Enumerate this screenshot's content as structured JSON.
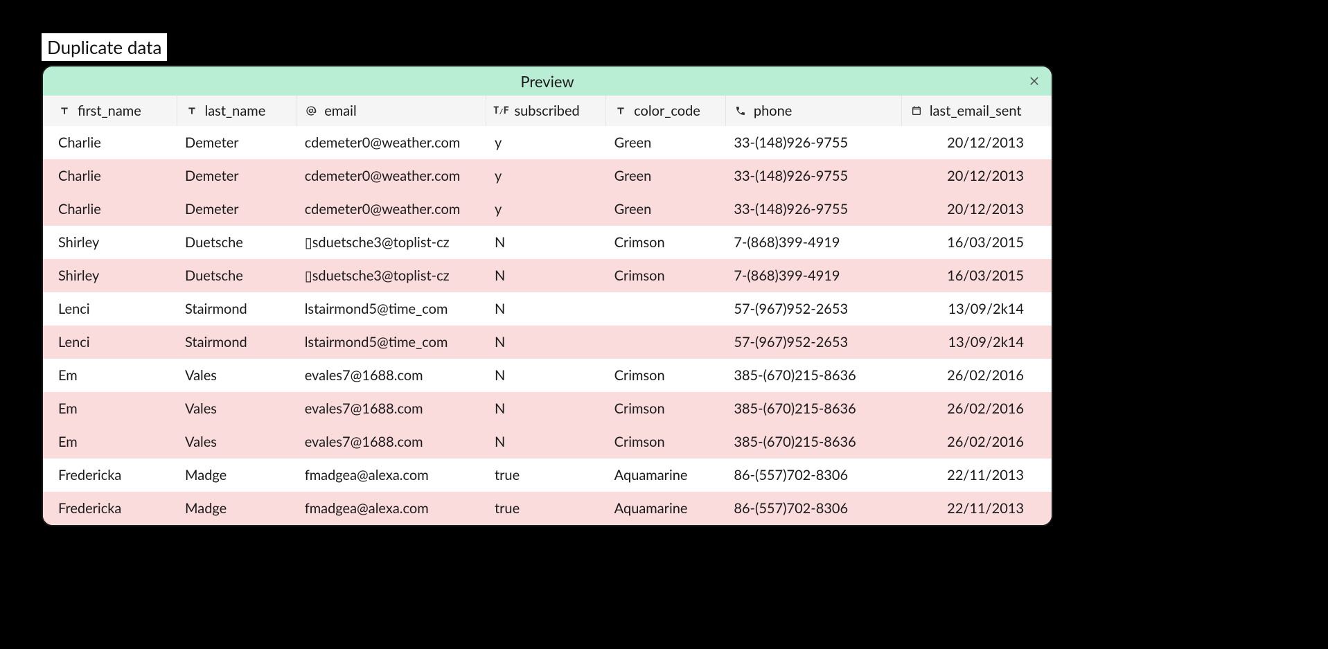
{
  "caption": "Duplicate data",
  "panel": {
    "title": "Preview"
  },
  "columns": [
    {
      "key": "first_name",
      "label": "first_name",
      "icon": "text"
    },
    {
      "key": "last_name",
      "label": "last_name",
      "icon": "text"
    },
    {
      "key": "email",
      "label": "email",
      "icon": "at"
    },
    {
      "key": "subscribed",
      "label": "subscribed",
      "icon": "bool"
    },
    {
      "key": "color_code",
      "label": "color_code",
      "icon": "text"
    },
    {
      "key": "phone",
      "label": "phone",
      "icon": "phone"
    },
    {
      "key": "last_email_sent",
      "label": "last_email_sent",
      "icon": "date"
    }
  ],
  "rows": [
    {
      "dup": false,
      "first_name": "Charlie",
      "last_name": "Demeter",
      "email": "cdemeter0@weather.com",
      "subscribed": "y",
      "color_code": "Green",
      "phone": "33-(148)926-9755",
      "last_email_sent": "20/12/2013"
    },
    {
      "dup": true,
      "first_name": "Charlie",
      "last_name": "Demeter",
      "email": "cdemeter0@weather.com",
      "subscribed": "y",
      "color_code": "Green",
      "phone": "33-(148)926-9755",
      "last_email_sent": "20/12/2013"
    },
    {
      "dup": true,
      "first_name": "Charlie",
      "last_name": "Demeter",
      "email": "cdemeter0@weather.com",
      "subscribed": "y",
      "color_code": "Green",
      "phone": "33-(148)926-9755",
      "last_email_sent": "20/12/2013"
    },
    {
      "dup": false,
      "first_name": "Shirley",
      "last_name": "Duetsche",
      "email": "▯sduetsche3@toplist-cz",
      "subscribed": "N",
      "color_code": "Crimson",
      "phone": "7-(868)399-4919",
      "last_email_sent": "16/03/2015"
    },
    {
      "dup": true,
      "first_name": "Shirley",
      "last_name": "Duetsche",
      "email": "▯sduetsche3@toplist-cz",
      "subscribed": "N",
      "color_code": "Crimson",
      "phone": "7-(868)399-4919",
      "last_email_sent": "16/03/2015"
    },
    {
      "dup": false,
      "first_name": "Lenci",
      "last_name": "Stairmond",
      "email": "lstairmond5@time_com",
      "subscribed": "N",
      "color_code": "",
      "phone": "57-(967)952-2653",
      "last_email_sent": "13/09/2k14"
    },
    {
      "dup": true,
      "first_name": "Lenci",
      "last_name": "Stairmond",
      "email": "lstairmond5@time_com",
      "subscribed": "N",
      "color_code": "",
      "phone": "57-(967)952-2653",
      "last_email_sent": "13/09/2k14"
    },
    {
      "dup": false,
      "first_name": "Em",
      "last_name": "Vales",
      "email": "evales7@1688.com",
      "subscribed": "N",
      "color_code": "Crimson",
      "phone": "385-(670)215-8636",
      "last_email_sent": "26/02/2016"
    },
    {
      "dup": true,
      "first_name": "Em",
      "last_name": "Vales",
      "email": "evales7@1688.com",
      "subscribed": "N",
      "color_code": "Crimson",
      "phone": "385-(670)215-8636",
      "last_email_sent": "26/02/2016"
    },
    {
      "dup": true,
      "first_name": "Em",
      "last_name": "Vales",
      "email": "evales7@1688.com",
      "subscribed": "N",
      "color_code": "Crimson",
      "phone": "385-(670)215-8636",
      "last_email_sent": "26/02/2016"
    },
    {
      "dup": false,
      "first_name": "Fredericka",
      "last_name": "Madge",
      "email": "fmadgea@alexa.com",
      "subscribed": "true",
      "color_code": "Aquamarine",
      "phone": "86-(557)702-8306",
      "last_email_sent": "22/11/2013"
    },
    {
      "dup": true,
      "first_name": "Fredericka",
      "last_name": "Madge",
      "email": "fmadgea@alexa.com",
      "subscribed": "true",
      "color_code": "Aquamarine",
      "phone": "86-(557)702-8306",
      "last_email_sent": "22/11/2013"
    }
  ]
}
